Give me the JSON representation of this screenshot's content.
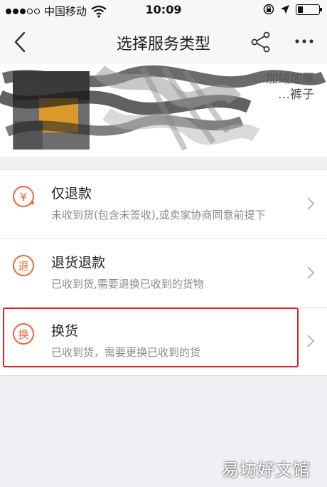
{
  "status_bar": {
    "carrier": "中国移动",
    "time": "10:09",
    "signal_filled": 3,
    "signal_total": 5
  },
  "nav": {
    "title": "选择服务类型",
    "back_icon": "chevron-left-icon",
    "share_icon": "share-icon",
    "more_icon": "more-dots-icon"
  },
  "product": {
    "title_line1": "…加绒加厚",
    "title_line2": "…裤子"
  },
  "options": [
    {
      "icon": "refund-yen-icon",
      "icon_text": "¥",
      "title": "仅退款",
      "desc": "未收到货(包含未签收),或卖家协商同意前提下"
    },
    {
      "icon": "return-refund-icon",
      "icon_text": "退",
      "title": "退货退款",
      "desc": "已收到货,需要退换已收到的货物"
    },
    {
      "icon": "exchange-icon",
      "icon_text": "换",
      "title": "换货",
      "desc": "已收到货，需要更换已收到的货"
    }
  ],
  "colors": {
    "accent": "#e8683a",
    "highlight": "#d92222",
    "background": "#efeff4"
  },
  "watermark": "易坊好文馆"
}
